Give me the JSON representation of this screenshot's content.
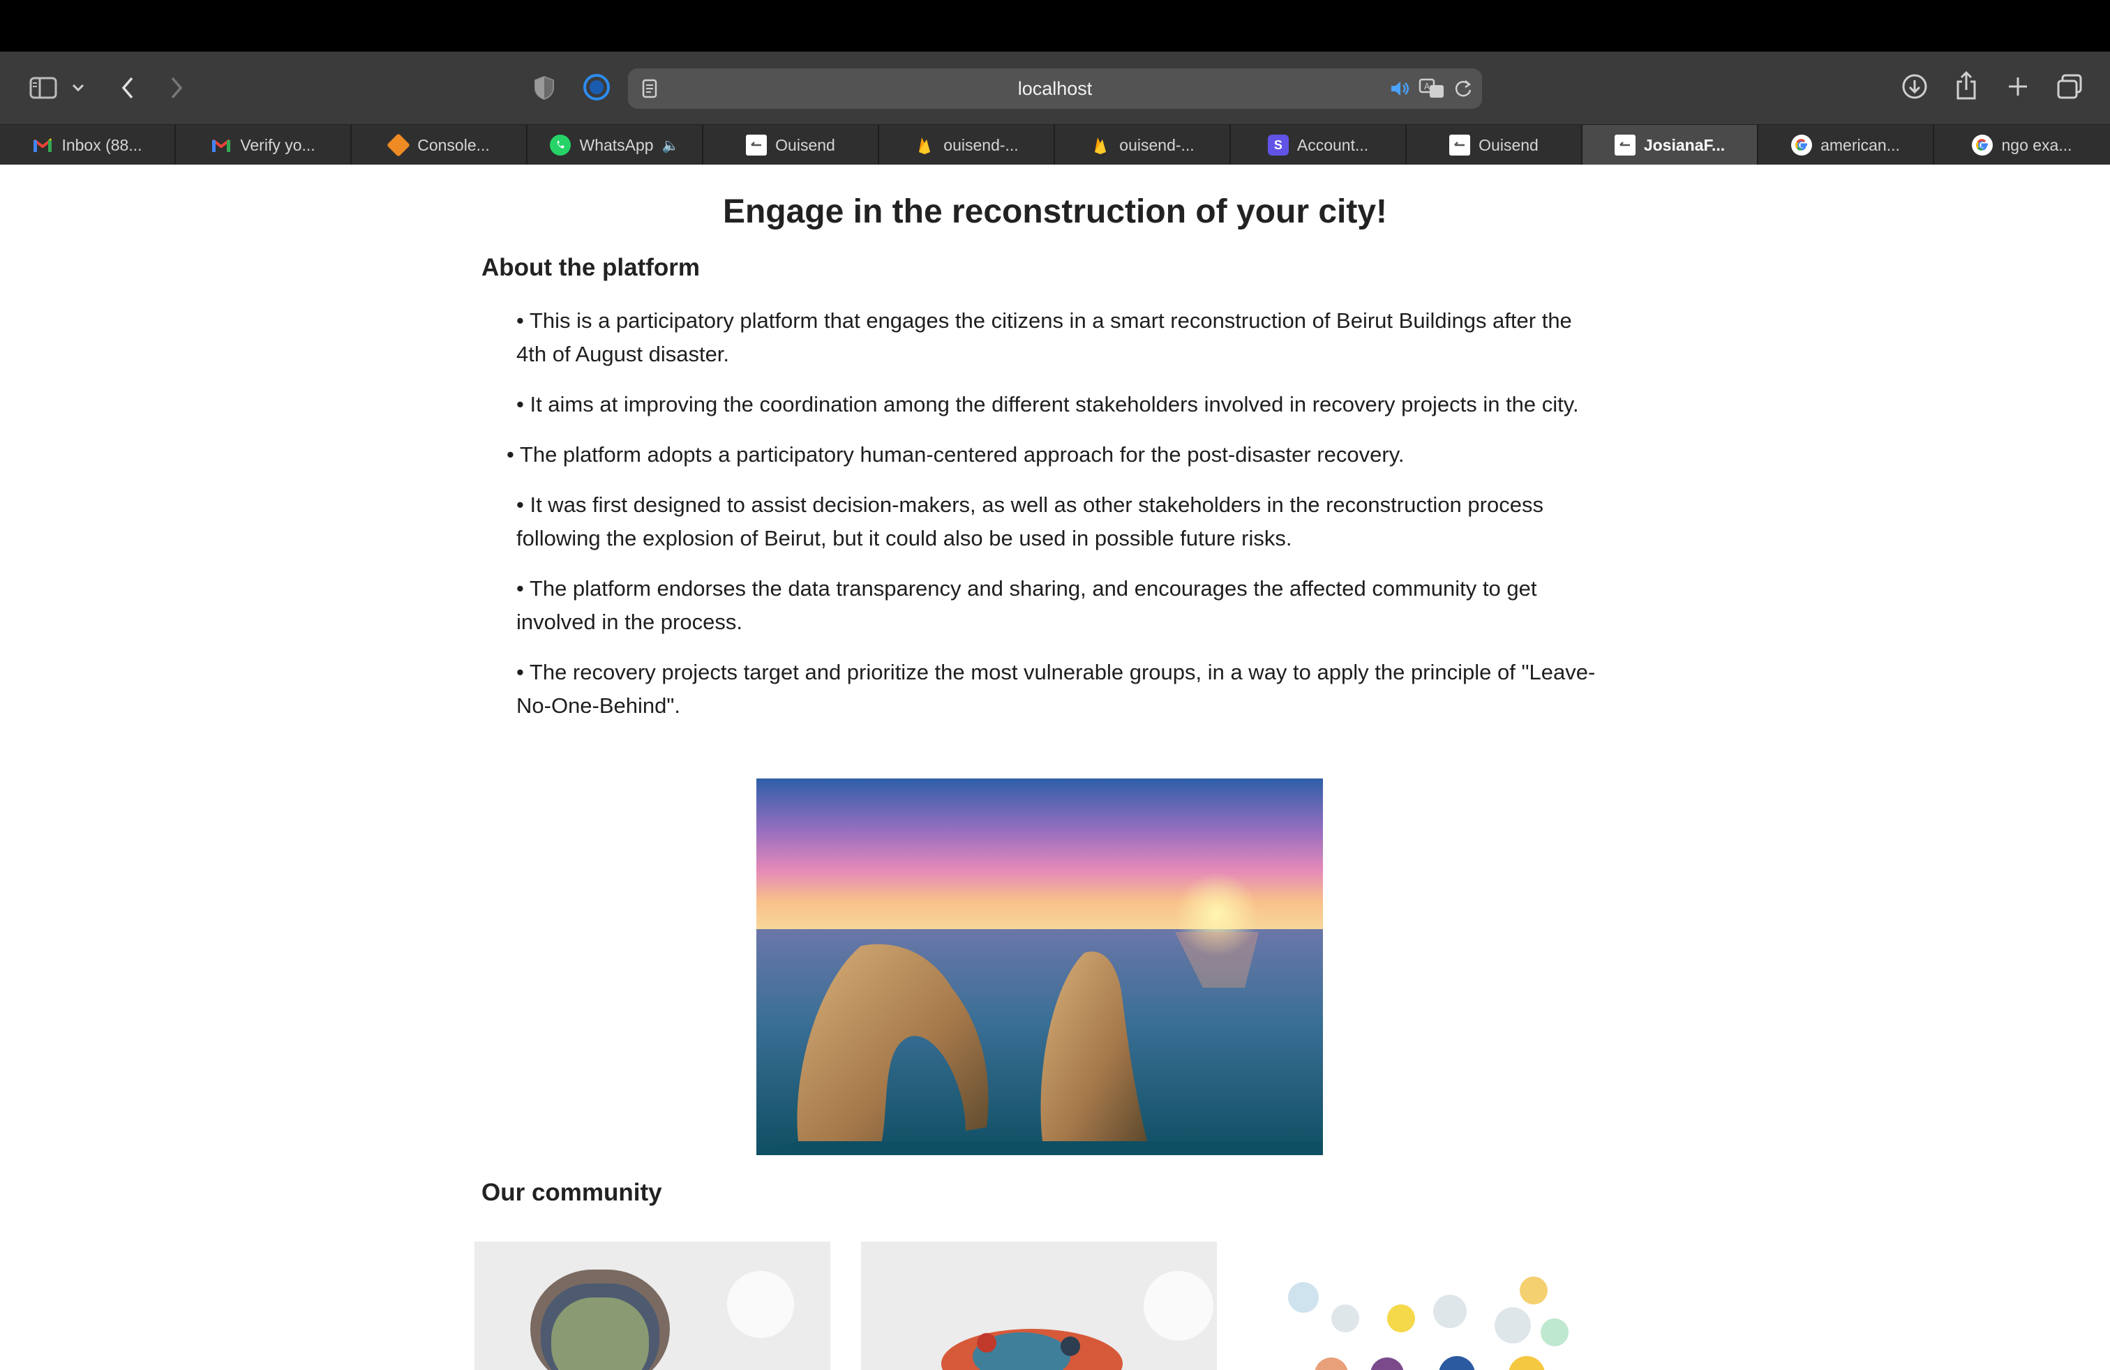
{
  "browser": {
    "url": "localhost",
    "tabs": [
      {
        "label": "Inbox (88...",
        "icon": "gmail-icon"
      },
      {
        "label": "Verify yo...",
        "icon": "gmail-icon"
      },
      {
        "label": "Console...",
        "icon": "cube-icon"
      },
      {
        "label": "WhatsApp",
        "icon": "whatsapp-icon"
      },
      {
        "label": "Ouisend",
        "icon": "ouisend-icon"
      },
      {
        "label": "ouisend-...",
        "icon": "firebase-icon"
      },
      {
        "label": "ouisend-...",
        "icon": "firebase-icon"
      },
      {
        "label": "Account...",
        "icon": "s-icon"
      },
      {
        "label": "Ouisend",
        "icon": "ouisend-icon"
      },
      {
        "label": "JosianaF...",
        "icon": "ouisend-icon",
        "active": true
      },
      {
        "label": "american...",
        "icon": "google-icon"
      },
      {
        "label": "ngo exa...",
        "icon": "google-icon"
      }
    ]
  },
  "page": {
    "title": "Engage in the reconstruction of your city!",
    "about_heading": "About the platform",
    "bullets": [
      "• This is a participatory platform that engages the citizens in a smart reconstruction of Beirut Buildings after the 4th of August disaster.",
      "• It aims at improving the coordination among the different stakeholders involved in recovery projects in the city.",
      "• The platform adopts a participatory human-centered approach for the post-disaster recovery.",
      "• It was first designed to assist decision-makers, as well as other stakeholders in the reconstruction process following the explosion of Beirut, but it could also be used in possible future risks.",
      "• The platform endorses the data transparency and sharing, and encourages the affected community to get involved in the process.",
      "• The recovery projects target and prioritize the most vulnerable groups, in a way to apply the principle of \"Leave-No-One-Behind\"."
    ],
    "community_heading": "Our community"
  },
  "colors": {
    "toolbar": "#3b3b3b",
    "tabstrip": "#2f2f2f",
    "active_tab": "#4a4a4a",
    "page_bg": "#ffffff",
    "text": "#222222"
  }
}
